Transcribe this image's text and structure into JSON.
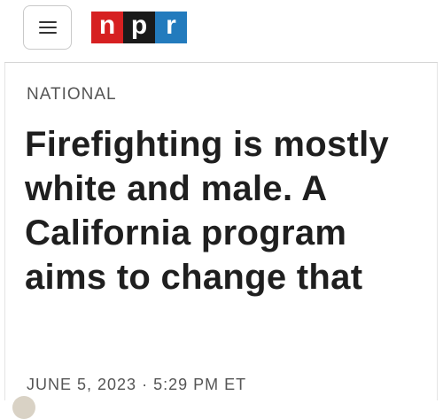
{
  "header": {
    "menu_icon": "hamburger-menu-icon",
    "logo": {
      "letters": [
        "n",
        "p",
        "r"
      ],
      "colors": [
        "#d62021",
        "#1a1a1a",
        "#237bbd"
      ]
    }
  },
  "article": {
    "section": "NATIONAL",
    "headline": "Firefighting is mostly white and male. A California program aims to change that",
    "date": "JUNE 5, 2023",
    "separator": "·",
    "time": "5:29 PM ET"
  }
}
